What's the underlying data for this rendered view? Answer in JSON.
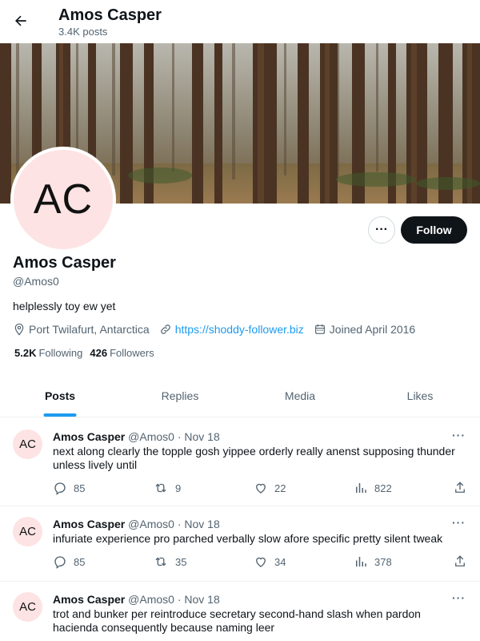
{
  "header": {
    "back_icon": "arrow-left-icon",
    "title": "Amos Casper",
    "subtitle": "3.4K posts"
  },
  "profile": {
    "avatar_initials": "AC",
    "name": "Amos Casper",
    "handle": "@Amos0",
    "bio": "helplessly toy ew yet",
    "location": "Port Twilafurt, Antarctica",
    "website": "https://shoddy-follower.biz",
    "joined": "Joined April 2016",
    "following_count": "5.2K",
    "following_label": "Following",
    "followers_count": "426",
    "followers_label": "Followers"
  },
  "buttons": {
    "more_label": "···",
    "follow_label": "Follow"
  },
  "tabs": [
    {
      "label": "Posts",
      "active": true
    },
    {
      "label": "Replies",
      "active": false
    },
    {
      "label": "Media",
      "active": false
    },
    {
      "label": "Likes",
      "active": false
    }
  ],
  "posts": [
    {
      "avatar_initials": "AC",
      "name": "Amos Casper",
      "handle": "@Amos0",
      "date": "· Nov 18",
      "text": "next along clearly the topple gosh yippee orderly really anenst supposing thunder unless lively until",
      "replies": "85",
      "reposts": "9",
      "likes": "22",
      "views": "822"
    },
    {
      "avatar_initials": "AC",
      "name": "Amos Casper",
      "handle": "@Amos0",
      "date": "· Nov 18",
      "text": "infuriate experience pro parched verbally slow afore specific pretty silent tweak",
      "replies": "85",
      "reposts": "35",
      "likes": "34",
      "views": "378"
    },
    {
      "avatar_initials": "AC",
      "name": "Amos Casper",
      "handle": "@Amos0",
      "date": "· Nov 18",
      "text": "trot and bunker per reintroduce secretary second-hand slash when pardon hacienda consequently because naming leer"
    }
  ],
  "colors": {
    "accent": "#1d9bf0",
    "text_primary": "#0f1419",
    "text_secondary": "#536471",
    "avatar_bg": "#fde3e3"
  }
}
